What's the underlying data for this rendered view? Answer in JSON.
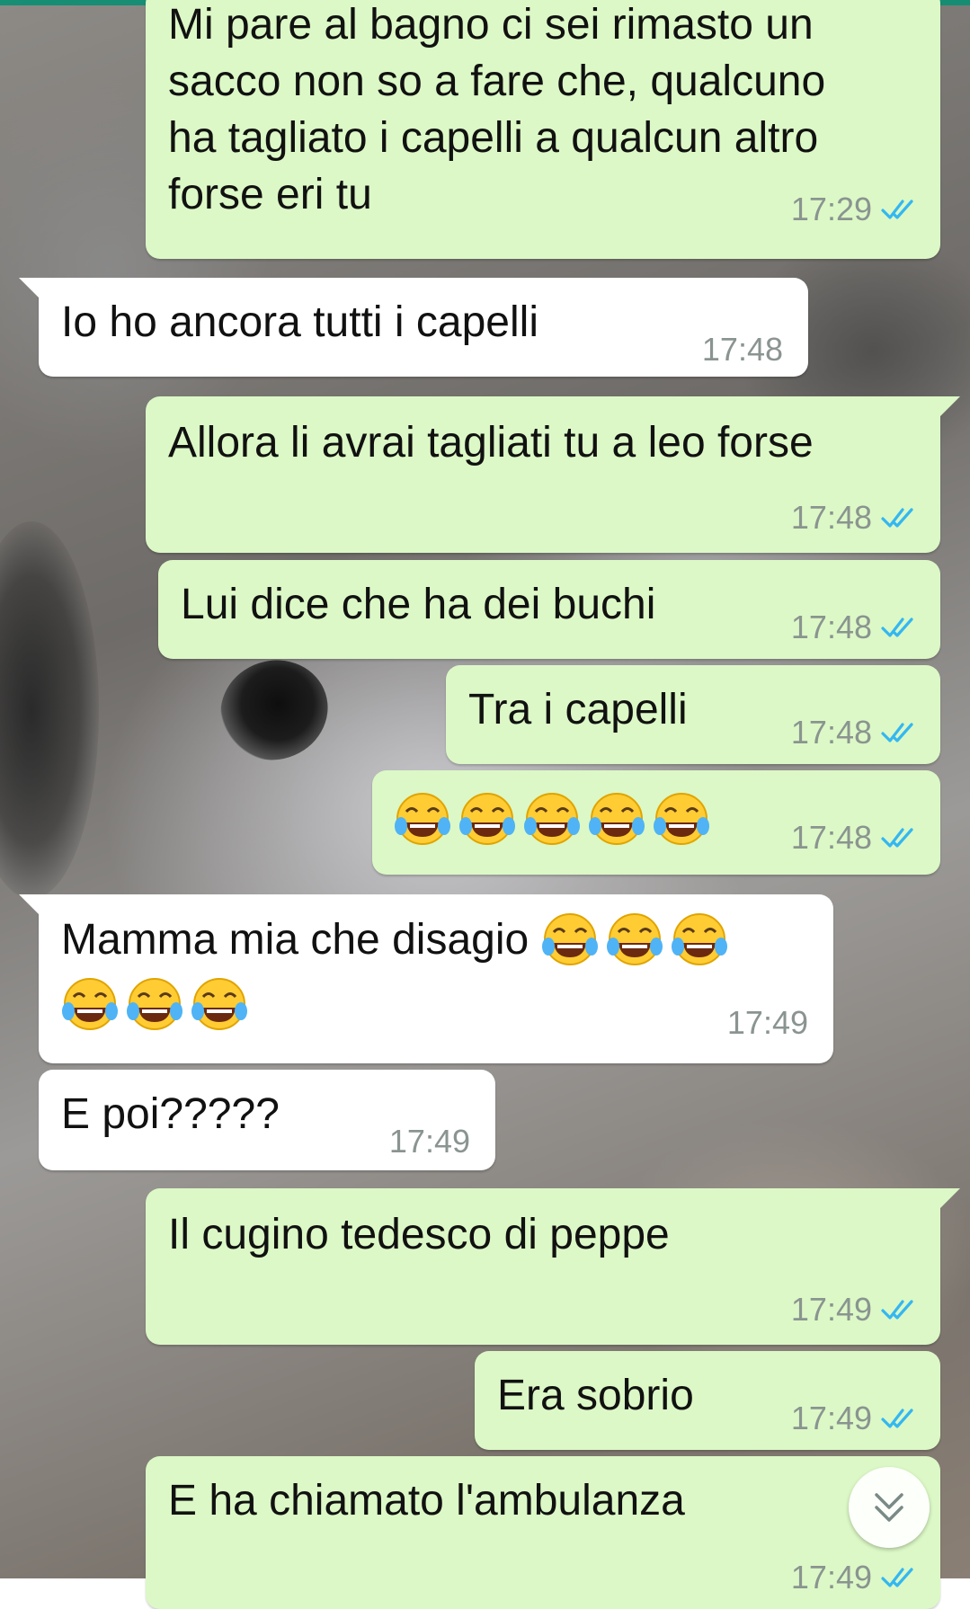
{
  "chat": {
    "messages": [
      {
        "dir": "out",
        "text": "Mi pare al bagno ci sei rimasto un\nsacco non so a fare che, qualcuno\nha tagliato i capelli a qualcun altro\nforse eri tu",
        "time": "17:29"
      },
      {
        "dir": "in",
        "text": "Io ho ancora tutti i capelli",
        "time": "17:48"
      },
      {
        "dir": "out",
        "text": "Allora li avrai tagliati tu a leo forse",
        "time": "17:48"
      },
      {
        "dir": "out",
        "text": "Lui dice che ha dei buchi",
        "time": "17:48"
      },
      {
        "dir": "out",
        "text": "Tra i capelli",
        "time": "17:48"
      },
      {
        "dir": "out",
        "emoji_count": 5,
        "time": "17:48"
      },
      {
        "dir": "in",
        "text": "Mamma mia che disagio",
        "emoji_count": 6,
        "time": "17:49"
      },
      {
        "dir": "in",
        "text": "E poi?????",
        "time": "17:49"
      },
      {
        "dir": "out",
        "text": "Il cugino tedesco di peppe",
        "time": "17:49"
      },
      {
        "dir": "out",
        "text": "Era sobrio",
        "time": "17:49"
      },
      {
        "dir": "out",
        "text": "E ha chiamato l'ambulanza",
        "time": "17:49"
      }
    ]
  },
  "icons": {
    "read_receipt": "double-check-icon",
    "emoji": "face-with-tears-of-joy-icon",
    "scroll_down": "chevron-double-down-icon"
  },
  "colors": {
    "outgoing_bubble": "#dcf8c6",
    "incoming_bubble": "#ffffff",
    "read_tick": "#34b7f1",
    "timestamp": "#8a9490"
  }
}
